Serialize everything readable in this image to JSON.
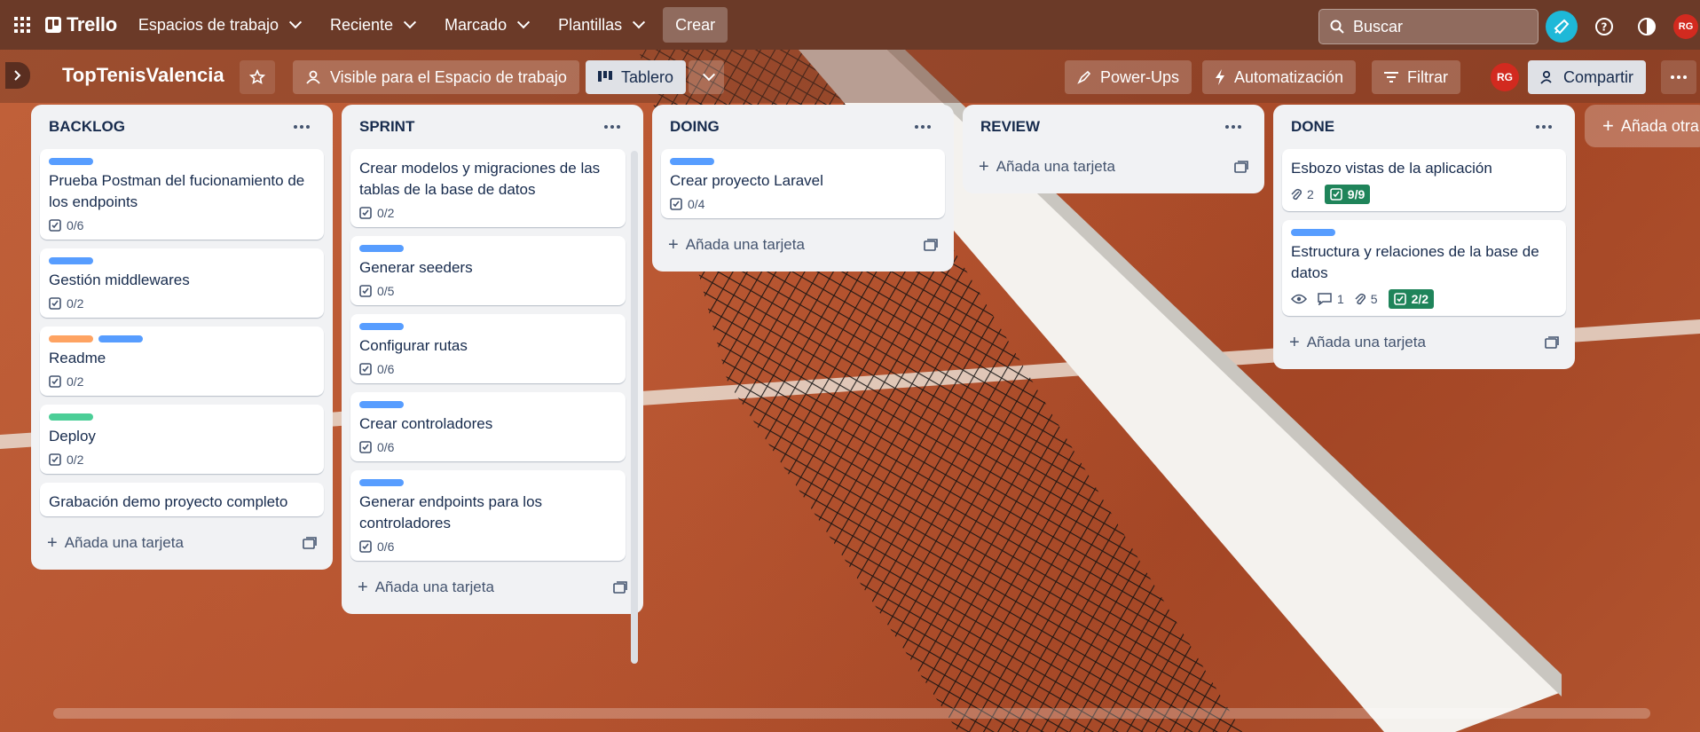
{
  "nav": {
    "brand": "Trello",
    "menus": [
      "Espacios de trabajo",
      "Reciente",
      "Marcado",
      "Plantillas"
    ],
    "create": "Crear",
    "search_placeholder": "Buscar",
    "avatar": "RG"
  },
  "board": {
    "title": "TopTenisValencia",
    "visibility": "Visible para el Espacio de trabajo",
    "view": "Tablero",
    "powerups": "Power-Ups",
    "automation": "Automatización",
    "filter": "Filtrar",
    "share": "Compartir",
    "member": "RG"
  },
  "add_card_label": "Añada una tarjeta",
  "add_list_label": "Añada otra",
  "colors": {
    "blue": "#579dff",
    "yellow": "#f5cd47",
    "green": "#4bce97",
    "orange": "#fea362",
    "done_badge": "#1f845a"
  },
  "lists": [
    {
      "title": "BACKLOG",
      "cards": [
        {
          "labels": [
            "blue"
          ],
          "title": "Prueba Postman del fucionamiento de los endpoints",
          "checklist": "0/6"
        },
        {
          "labels": [
            "blue"
          ],
          "title": "Gestión middlewares",
          "checklist": "0/2"
        },
        {
          "labels": [
            "orange",
            "blue"
          ],
          "title": "Readme",
          "checklist": "0/2"
        },
        {
          "labels": [
            "green"
          ],
          "title": "Deploy",
          "checklist": "0/2"
        },
        {
          "labels": [],
          "title": "Grabación demo proyecto completo",
          "checklist": ""
        }
      ]
    },
    {
      "title": "SPRINT",
      "cards": [
        {
          "labels": [],
          "title": "Crear modelos y migraciones de las tablas de la base de datos",
          "checklist": "0/2"
        },
        {
          "labels": [
            "blue"
          ],
          "title": "Generar seeders",
          "checklist": "0/5"
        },
        {
          "labels": [
            "blue"
          ],
          "title": "Configurar rutas",
          "checklist": "0/6"
        },
        {
          "labels": [
            "blue"
          ],
          "title": "Crear controladores",
          "checklist": "0/6"
        },
        {
          "labels": [
            "blue"
          ],
          "title": "Generar endpoints para los controladores",
          "checklist": "0/6"
        }
      ]
    },
    {
      "title": "DOING",
      "cards": [
        {
          "labels": [
            "blue"
          ],
          "title": "Crear proyecto Laravel",
          "checklist": "0/4"
        }
      ]
    },
    {
      "title": "REVIEW",
      "cards": []
    },
    {
      "title": "DONE",
      "cards": [
        {
          "labels": [],
          "title": "Esbozo vistas de la aplicación",
          "attachments": "2",
          "checklist_done": "9/9"
        },
        {
          "labels": [
            "blue"
          ],
          "title": "Estructura y relaciones de la base de datos",
          "comments": "1",
          "attachments": "5",
          "checklist_done": "2/2",
          "watching": true
        }
      ]
    }
  ]
}
